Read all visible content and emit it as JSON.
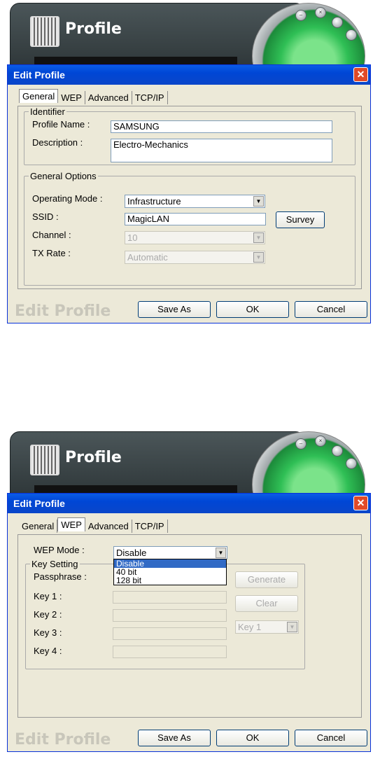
{
  "app": {
    "title": "Profile"
  },
  "dialog": {
    "title": "Edit Profile",
    "footer_label": "Edit Profile",
    "tabs": [
      "General",
      "WEP",
      "Advanced",
      "TCP/IP"
    ],
    "buttons": {
      "save_as": "Save As",
      "ok": "OK",
      "cancel": "Cancel"
    }
  },
  "general": {
    "identifier_legend": "Identifier",
    "profile_name_label": "Profile Name :",
    "profile_name_value": "SAMSUNG",
    "description_label": "Description :",
    "description_value": "Electro-Mechanics",
    "options_legend": "General Options",
    "operating_mode_label": "Operating Mode :",
    "operating_mode_value": "Infrastructure",
    "ssid_label": "SSID :",
    "ssid_value": "MagicLAN",
    "survey_button": "Survey",
    "channel_label": "Channel :",
    "channel_value": "10",
    "tx_rate_label": "TX Rate :",
    "tx_rate_value": "Automatic"
  },
  "wep": {
    "mode_label": "WEP Mode :",
    "mode_value": "Disable",
    "mode_options": [
      "Disable",
      "40 bit",
      "128 bit"
    ],
    "key_setting_legend": "Key Setting",
    "passphrase_label": "Passphrase :",
    "key1_label": "Key 1 :",
    "key2_label": "Key 2 :",
    "key3_label": "Key 3 :",
    "key4_label": "Key 4 :",
    "generate_button": "Generate",
    "clear_button": "Clear",
    "key_select_value": "Key 1"
  }
}
